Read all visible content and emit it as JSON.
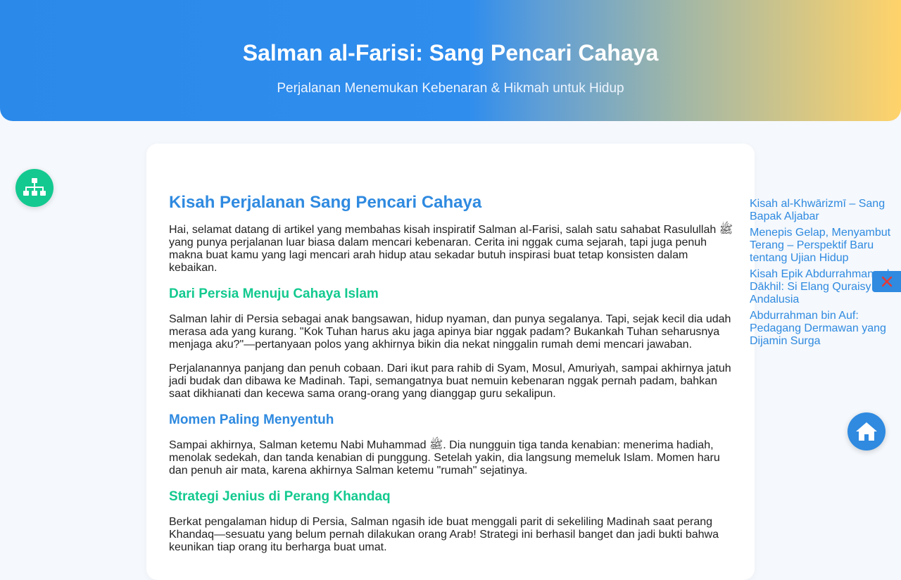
{
  "header": {
    "title": "Salman al-Farisi: Sang Pencari Cahaya",
    "subtitle": "Perjalanan Menemukan Kebenaran & Hikmah untuk Hidup"
  },
  "article": {
    "heading": "Kisah Perjalanan Sang Pencari Cahaya",
    "intro": "Hai, selamat datang di artikel yang membahas kisah inspiratif Salman al-Farisi, salah satu sahabat Rasulullah ﷺ yang punya perjalanan luar biasa dalam mencari kebenaran. Cerita ini nggak cuma sejarah, tapi juga penuh makna buat kamu yang lagi mencari arah hidup atau sekadar butuh inspirasi buat tetap konsisten dalam kebaikan.",
    "sections": [
      {
        "title": "Dari Persia Menuju Cahaya Islam",
        "paragraphs": [
          "Salman lahir di Persia sebagai anak bangsawan, hidup nyaman, dan punya segalanya. Tapi, sejak kecil dia udah merasa ada yang kurang. \"Kok Tuhan harus aku jaga apinya biar nggak padam? Bukankah Tuhan seharusnya menjaga aku?\"—pertanyaan polos yang akhirnya bikin dia nekat ninggalin rumah demi mencari jawaban.",
          "Perjalanannya panjang dan penuh cobaan. Dari ikut para rahib di Syam, Mosul, Amuriyah, sampai akhirnya jatuh jadi budak dan dibawa ke Madinah. Tapi, semangatnya buat nemuin kebenaran nggak pernah padam, bahkan saat dikhianati dan kecewa sama orang-orang yang dianggap guru sekalipun."
        ]
      },
      {
        "title": "Momen Paling Menyentuh",
        "paragraphs": [
          "Sampai akhirnya, Salman ketemu Nabi Muhammad ﷺ. Dia nungguin tiga tanda kenabian: menerima hadiah, menolak sedekah, dan tanda kenabian di punggung. Setelah yakin, dia langsung memeluk Islam. Momen haru dan penuh air mata, karena akhirnya Salman ketemu \"rumah\" sejatinya."
        ]
      },
      {
        "title": "Strategi Jenius di Perang Khandaq",
        "paragraphs": [
          "Berkat pengalaman hidup di Persia, Salman ngasih ide buat menggali parit di sekeliling Madinah saat perang Khandaq—sesuatu yang belum pernah dilakukan orang Arab! Strategi ini berhasil banget dan jadi bukti bahwa keunikan tiap orang itu berharga buat umat."
        ]
      }
    ]
  },
  "related_links": [
    "Kisah al-Khwārizmī – Sang Bapak Aljabar",
    "Menepis Gelap, Menyambut Terang – Perspektif Baru tentang Ujian Hidup",
    "Kisah Epik Abdurrahman ad-Dākhil: Si Elang Quraisy di Andalusia",
    "Abdurrahman bin Auf: Pedagang Dermawan yang Dijamin Surga"
  ],
  "icons": {
    "sitemap": "sitemap-icon",
    "home": "home-icon",
    "close": "close-icon"
  },
  "colors": {
    "accent_blue": "#2f8ae0",
    "accent_green": "#13c98f",
    "close_red": "#e53935"
  }
}
